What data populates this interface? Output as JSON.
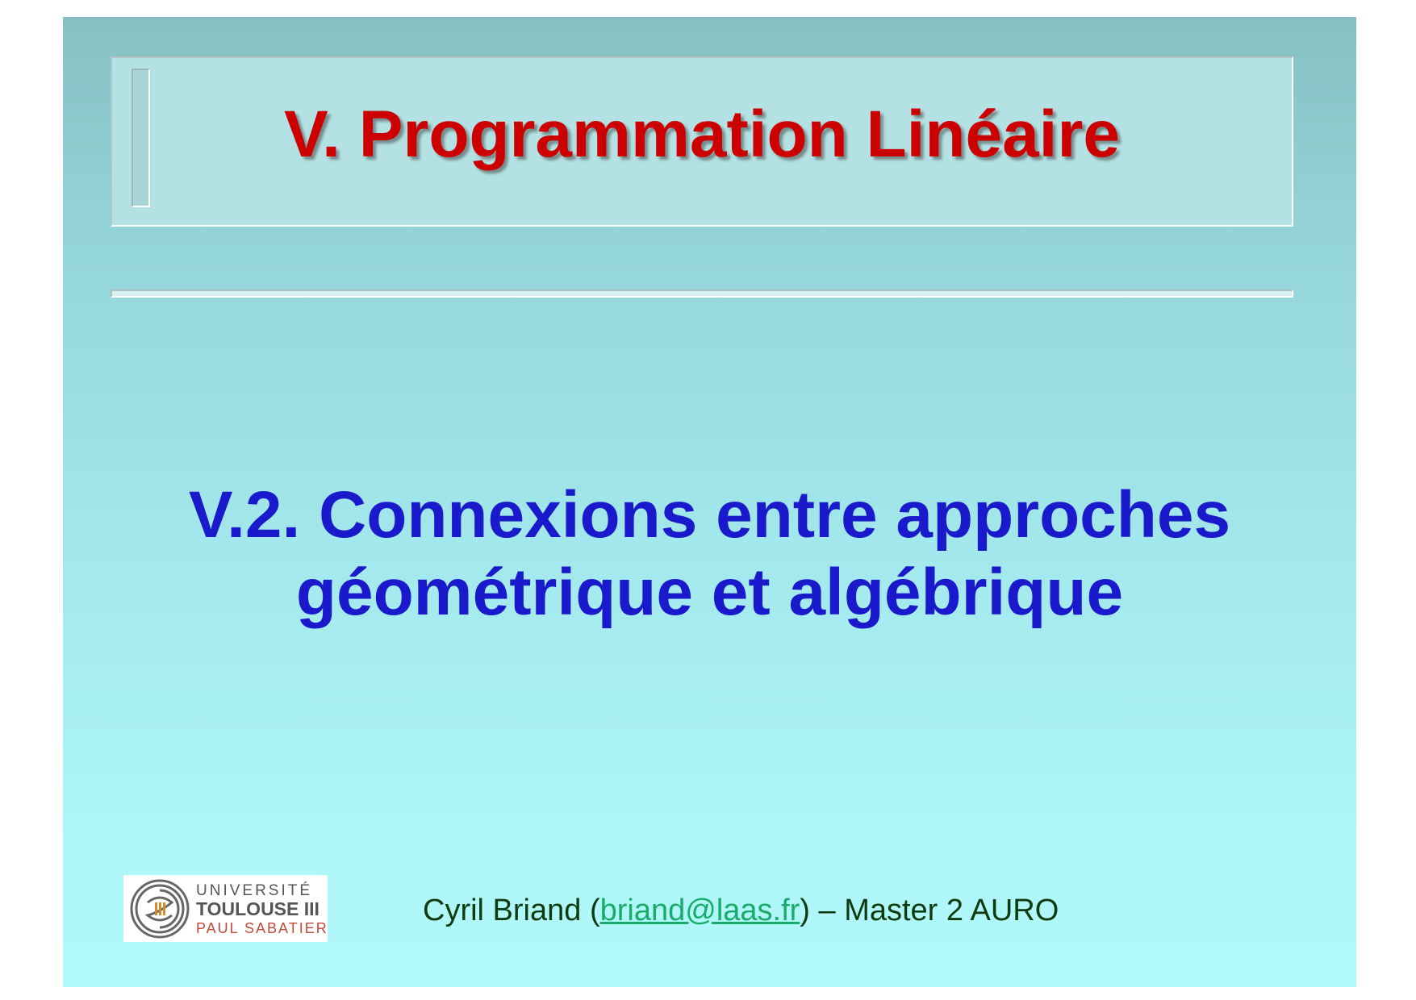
{
  "slide": {
    "title": "V. Programmation Linéaire",
    "subtitle_line1": "V.2. Connexions entre approches",
    "subtitle_line2": "géométrique et algébrique"
  },
  "logo": {
    "line1": "UNIVERSITÉ",
    "line2": "TOULOUSE III",
    "line3": "PAUL SABATIER"
  },
  "footer": {
    "author": "Cyril Briand (",
    "email": "briand@laas.fr",
    "suffix": ") – Master 2 AURO"
  },
  "colors": {
    "title": "#cc0000",
    "subtitle": "#1a1acc",
    "footer": "#0e3a10",
    "link": "#1aaa6a"
  }
}
